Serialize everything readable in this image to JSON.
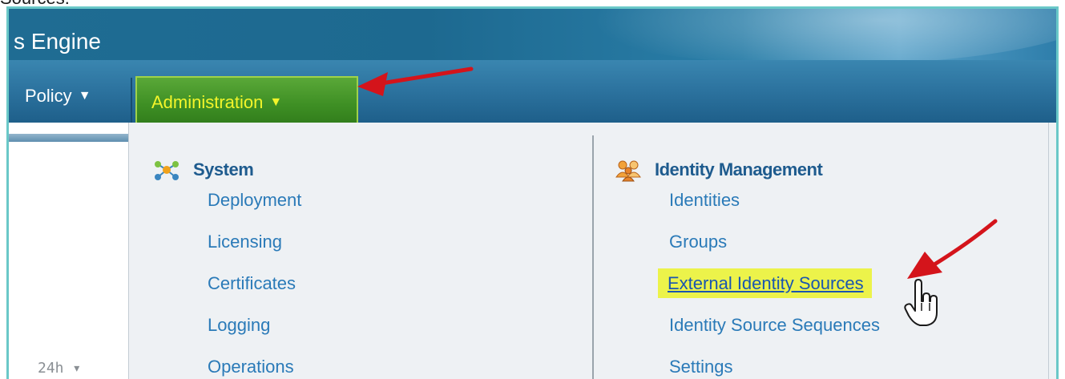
{
  "caption_fragment": "Sources.",
  "window": {
    "title": "s Engine"
  },
  "navbar": {
    "policy_label": "Policy",
    "administration_label": "Administration",
    "caret": "▼"
  },
  "left_panel": {
    "time_range": "24h",
    "time_range_caret": "▾"
  },
  "menu": {
    "system": {
      "heading": "System",
      "items": [
        "Deployment",
        "Licensing",
        "Certificates",
        "Logging",
        "Operations"
      ]
    },
    "identity_management": {
      "heading": "Identity Management",
      "items": [
        "Identities",
        "Groups",
        "External Identity Sources",
        "Identity Source Sequences",
        "Settings"
      ],
      "highlighted_item": "External Identity Sources"
    }
  },
  "colors": {
    "header_blue": "#1f6c93",
    "admin_tab_green": "#3e8f24",
    "admin_tab_text": "#f3f52a",
    "link_blue": "#2a7ab8",
    "heading_blue": "#1e5b8e",
    "highlight_yellow": "#ecf34a",
    "annotation_red": "#d4141b"
  },
  "icons": {
    "system": "network-nodes-icon",
    "identity": "users-group-icon",
    "cursor": "hand-pointer-icon"
  }
}
